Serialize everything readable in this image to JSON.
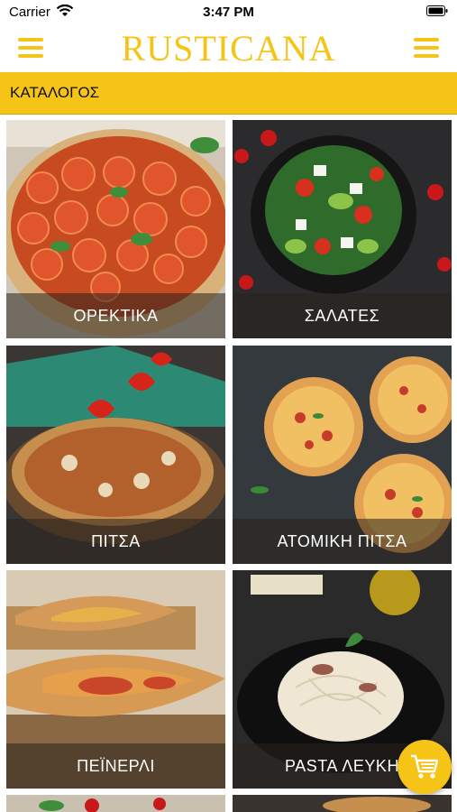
{
  "status_bar": {
    "carrier": "Carrier",
    "time": "3:47 PM"
  },
  "header": {
    "brand": "RUSTICANA"
  },
  "section": {
    "title": "ΚΑΤΑΛΟΓΟΣ"
  },
  "categories": [
    {
      "label": "ΟΡΕΚΤΙΚΑ"
    },
    {
      "label": "ΣΑΛΑΤΕΣ"
    },
    {
      "label": "ΠΙΤΣΑ"
    },
    {
      "label": "ΑΤΟΜΙΚΗ ΠΙΤΣΑ"
    },
    {
      "label": "ΠΕΪΝΕΡΛΙ"
    },
    {
      "label": "PASTA ΛΕΥΚΗ"
    }
  ],
  "colors": {
    "accent": "#f6c417",
    "section_bar": "#f6c417"
  },
  "icons": {
    "menu": "hamburger-menu-icon",
    "cart": "shopping-cart-icon"
  }
}
